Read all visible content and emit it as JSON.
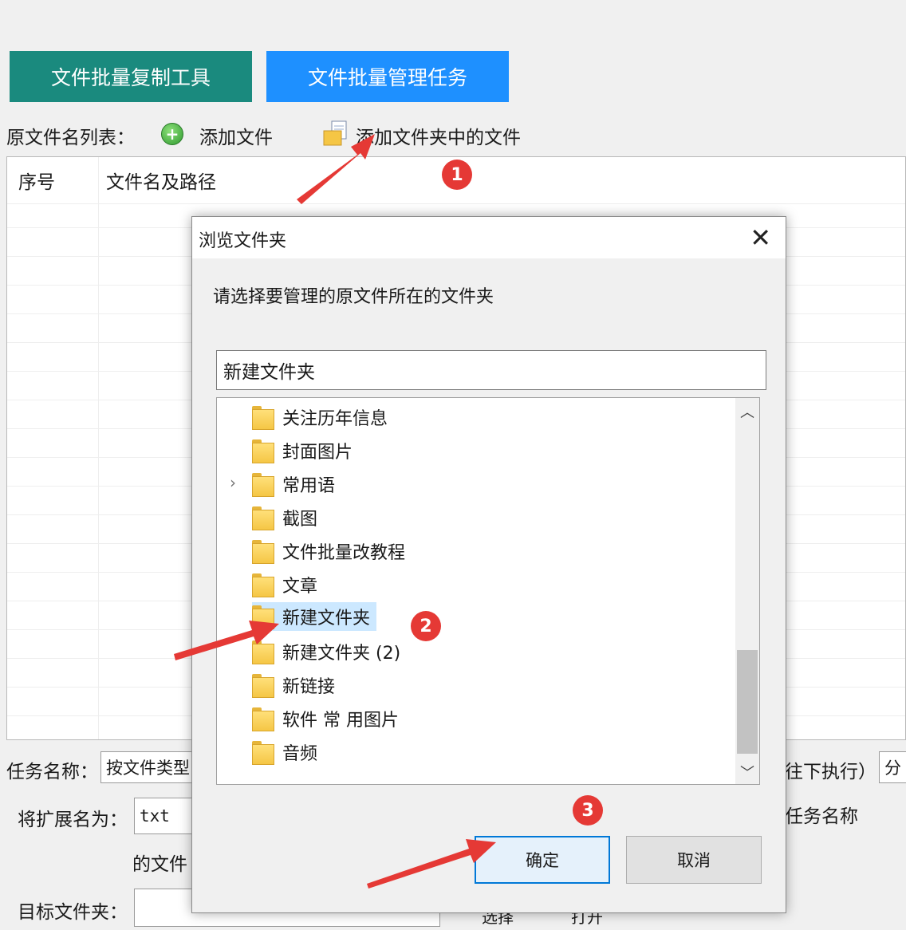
{
  "top_buttons": {
    "copy_tool": "文件批量复制工具",
    "manage_tasks": "文件批量管理任务"
  },
  "toolbar": {
    "list_label": "原文件名列表：",
    "add_file": "添加文件",
    "add_folder_files": "添加文件夹中的文件"
  },
  "list": {
    "col_index": "序号",
    "col_path": "文件名及路径"
  },
  "bottom": {
    "task_name_label": "任务名称：",
    "task_name_value": "按文件类型",
    "execute_label": "往下执行）",
    "split_btn": "分",
    "ext_label": "将扩展名为：",
    "ext_value": "txt",
    "task_name_right": "任务名称",
    "files_of": "的文件",
    "target_folder_label": "目标文件夹：",
    "select_btn": "选择",
    "open_btn": "打开"
  },
  "dialog": {
    "title": "浏览文件夹",
    "close": "✕",
    "prompt": "请选择要管理的原文件所在的文件夹",
    "path_value": "新建文件夹",
    "folders": [
      "关注历年信息",
      "封面图片",
      "常用语",
      "截图",
      "文件批量改教程",
      "文章",
      "新建文件夹",
      "新建文件夹 (2)",
      "新链接",
      "软件 常 用图片",
      "音频"
    ],
    "selected_folder": "新建文件夹",
    "ok": "确定",
    "cancel": "取消"
  },
  "annotations": {
    "step1": "1",
    "step2": "2",
    "step3": "3"
  },
  "colors": {
    "teal": "#1a8a7e",
    "blue": "#1e90ff",
    "badge": "#e53935",
    "selected": "#cce8ff",
    "focus": "#0078d7"
  }
}
